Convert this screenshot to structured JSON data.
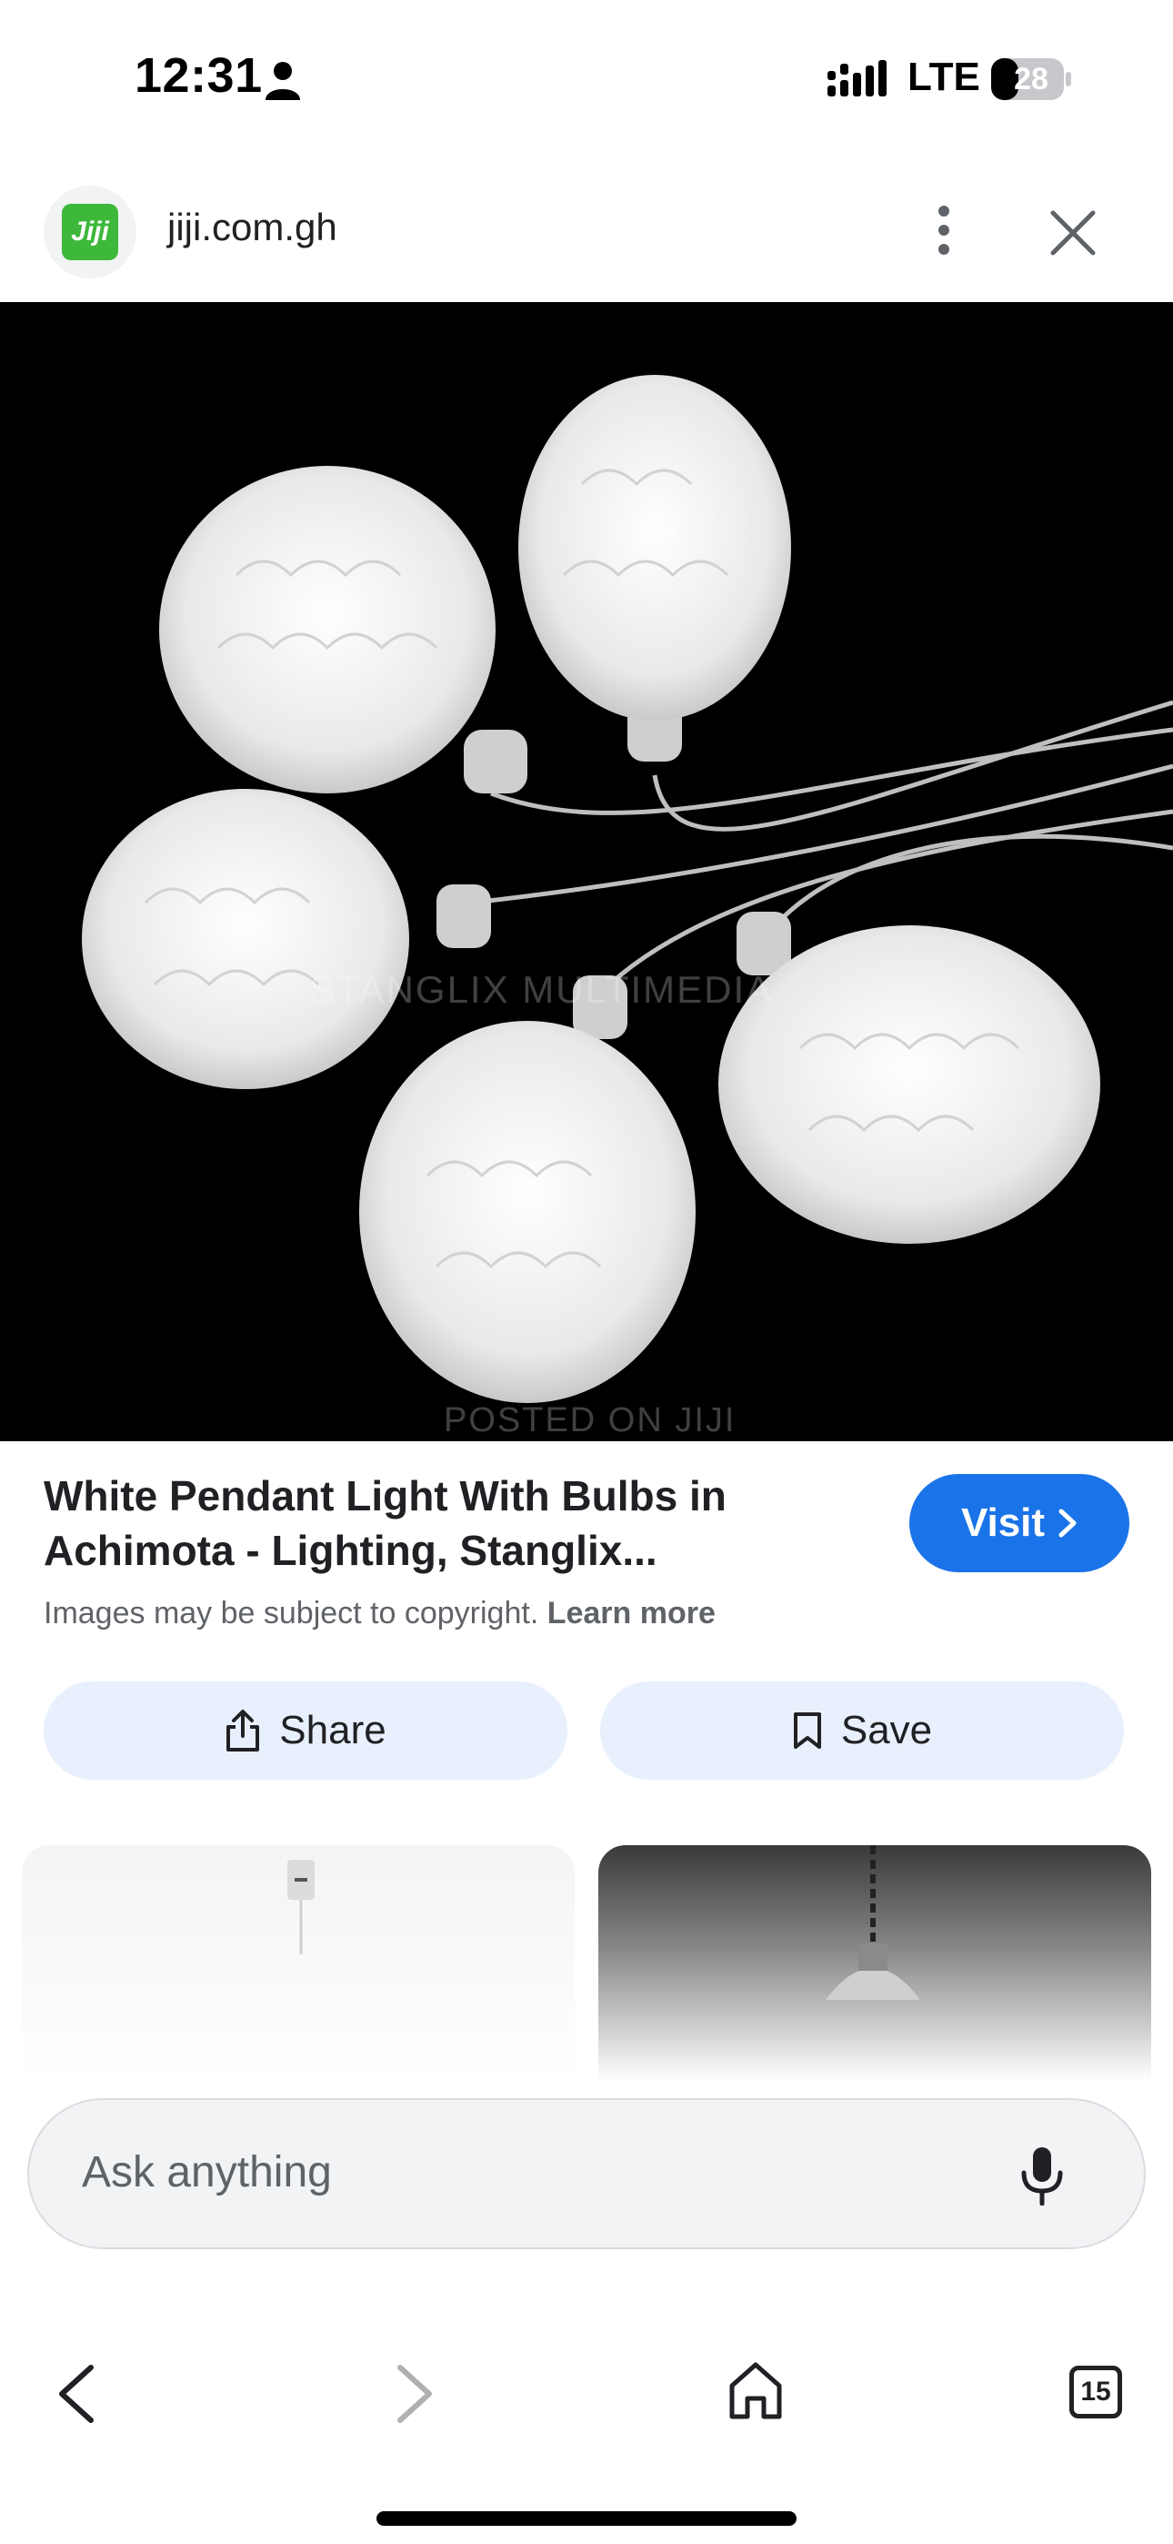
{
  "status_bar": {
    "time": "12:31",
    "network": "LTE",
    "battery": "28"
  },
  "header": {
    "domain": "jiji.com.gh",
    "logo_text": "Jiji"
  },
  "image": {
    "alt": "White pendant lights",
    "watermarks": [
      "POSTED ON JIJI",
      "STANGLIX MULTIMEDIA"
    ]
  },
  "result": {
    "title": "White Pendant Light With Bulbs in Achimota - Lighting, Stanglix...",
    "visit_label": "Visit",
    "copyright_text": "Images may be subject to copyright.",
    "learn_more": "Learn more"
  },
  "actions": {
    "share_label": "Share",
    "save_label": "Save"
  },
  "search": {
    "placeholder": "Ask anything"
  },
  "bottom_nav": {
    "tab_count": "15"
  },
  "icons": [
    "person-icon",
    "signal-icon",
    "battery-icon",
    "more-icon",
    "close-icon",
    "share-icon",
    "bookmark-icon",
    "mic-icon",
    "back-icon",
    "forward-icon",
    "home-icon",
    "tabs-icon"
  ],
  "colors": {
    "accent": "#1a73e8",
    "chip_bg": "#e8f0fe",
    "logo_green": "#3db83a"
  }
}
